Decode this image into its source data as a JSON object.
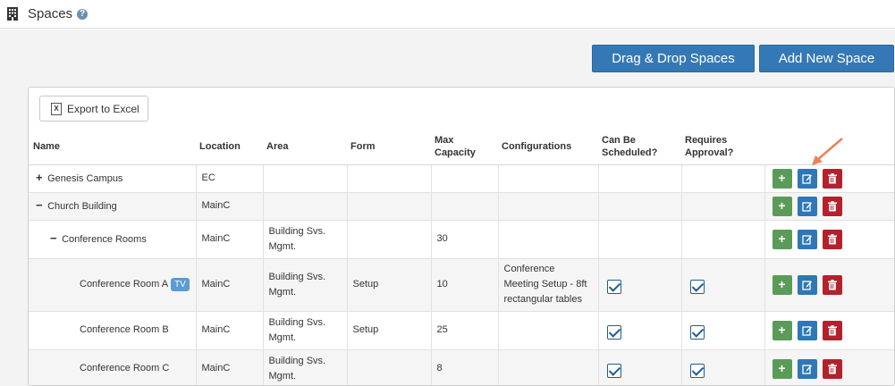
{
  "header": {
    "title": "Spaces",
    "help_glyph": "?"
  },
  "toolbar": {
    "drag_drop_label": "Drag & Drop Spaces",
    "add_new_label": "Add New Space"
  },
  "panel": {
    "export_label": "Export to Excel",
    "export_glyph": "X"
  },
  "table": {
    "columns": [
      "Name",
      "Location",
      "Area",
      "Form",
      "Max Capacity",
      "Configurations",
      "Can Be Scheduled?",
      "Requires Approval?",
      ""
    ],
    "rows": [
      {
        "toggle": "+",
        "name": "Genesis Campus",
        "location": "EC",
        "area": "",
        "form": "",
        "capacity": "",
        "config": "",
        "scheduled": false,
        "approval": false,
        "indent": 0
      },
      {
        "toggle": "−",
        "name": "Church Building",
        "location": "MainC",
        "area": "",
        "form": "",
        "capacity": "",
        "config": "",
        "scheduled": false,
        "approval": false,
        "indent": 0
      },
      {
        "toggle": "−",
        "name": "Conference Rooms",
        "location": "MainC",
        "area": "Building Svs. Mgmt.",
        "form": "",
        "capacity": "30",
        "config": "",
        "scheduled": false,
        "approval": false,
        "indent": 1
      },
      {
        "toggle": "",
        "name": "Conference Room A",
        "badge": "TV",
        "location": "MainC",
        "area": "Building Svs. Mgmt.",
        "form": "Setup",
        "capacity": "10",
        "config": "Conference Meeting Setup - 8ft rectangular tables",
        "scheduled": true,
        "approval": true,
        "indent": 2
      },
      {
        "toggle": "",
        "name": "Conference Room B",
        "location": "MainC",
        "area": "Building Svs. Mgmt.",
        "form": "Setup",
        "capacity": "25",
        "config": "",
        "scheduled": true,
        "approval": true,
        "indent": 2
      },
      {
        "toggle": "",
        "name": "Conference Room C",
        "location": "MainC",
        "area": "Building Svs. Mgmt.",
        "form": "",
        "capacity": "8",
        "config": "",
        "scheduled": true,
        "approval": true,
        "indent": 2
      }
    ]
  },
  "action_icons": {
    "add": "plus-icon",
    "edit": "edit-icon",
    "delete": "trash-icon"
  },
  "colors": {
    "primary": "#3479b5",
    "add": "#5b9b59",
    "edit": "#2f77b6",
    "delete": "#b3212c",
    "badge": "#5b9bd5",
    "arrow": "#e8825a"
  }
}
